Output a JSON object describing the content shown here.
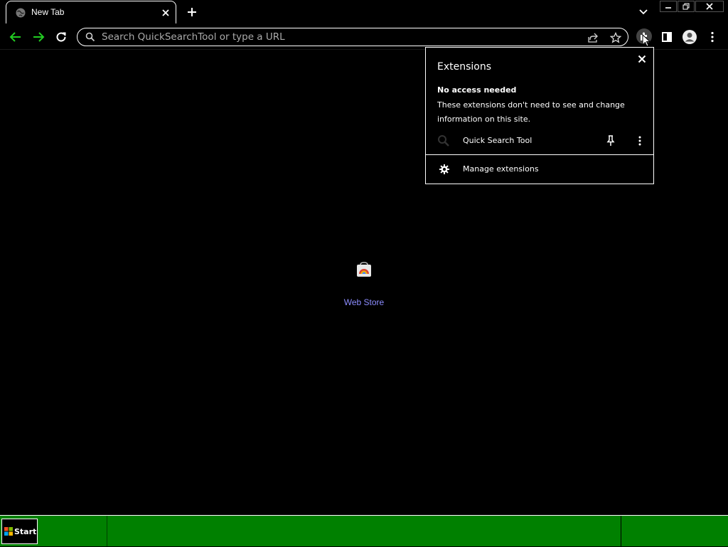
{
  "browser": {
    "tab": {
      "title": "New Tab",
      "favicon": "globe-icon"
    },
    "omnibox": {
      "placeholder": "Search QuickSearchTool or type a URL"
    }
  },
  "extensions_popup": {
    "title": "Extensions",
    "section_title": "No access needed",
    "section_desc": "These extensions don't need to see and change information on this site.",
    "items": [
      {
        "name": "Quick Search Tool",
        "icon": "magnifier-icon"
      }
    ],
    "manage_label": "Manage extensions"
  },
  "content": {
    "shortcut_label": "Web Store"
  },
  "taskbar": {
    "start_label": "Start"
  },
  "colors": {
    "accent_green": "#22cc22",
    "taskbar_green": "#008000",
    "link_blue": "#8c8cff"
  }
}
